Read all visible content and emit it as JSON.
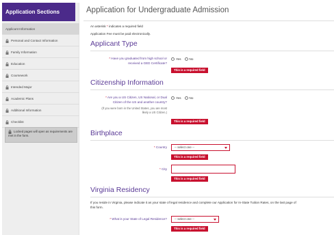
{
  "sidebar": {
    "title": "Application Sections",
    "items": [
      {
        "label": "Applicant Information",
        "locked": false,
        "active": true
      },
      {
        "label": "Personal and Contact Information",
        "locked": true
      },
      {
        "label": "Family Information",
        "locked": true
      },
      {
        "label": "Education",
        "locked": true
      },
      {
        "label": "Coursework",
        "locked": true
      },
      {
        "label": "Intended Major",
        "locked": true
      },
      {
        "label": "Academic Plans",
        "locked": true
      },
      {
        "label": "Additional Information",
        "locked": true
      },
      {
        "label": "Checklist",
        "locked": true
      }
    ],
    "note": "Locked pages will open as requirements are met in the form."
  },
  "main": {
    "title": "Application for Undergraduate Admission",
    "required_note_before": "An asterisk",
    "required_note_after": "indicates a required field",
    "fee_note": "Application Fee must be paid electronically.",
    "error_text": "This is a required field"
  },
  "applicant_type": {
    "heading": "Applicant Type",
    "question_line1": "Have you graduated from high school or",
    "question_line2": "received a GED Certificate?",
    "yes": "Yes",
    "no": "No"
  },
  "citizenship": {
    "heading": "Citizenship Information",
    "question_line1": "Are you a US Citizen, US National, or Dual",
    "question_line2": "Citizen of the US and another country?",
    "hint_line1": "(If you were born in the United States, you are most",
    "hint_line2": "likely a US Citizen.)",
    "yes": "Yes",
    "no": "No"
  },
  "birthplace": {
    "heading": "Birthplace",
    "country_label": "Country",
    "country_value": "-- select one --",
    "city_label": "City",
    "city_value": ""
  },
  "residency": {
    "heading": "Virginia Residency",
    "paragraph_line1": "If you reside in Virginia, please indicate it as your state of legal residence and complete our Application for In-State Tuition Rates, on the last page of",
    "paragraph_line2": "this form.",
    "state_label": "What is your State of Legal Residence?",
    "state_value": "-- select one --"
  },
  "colors": {
    "brand": "#4b2a8a",
    "heading": "#5a3a96",
    "error": "#c8102e"
  }
}
